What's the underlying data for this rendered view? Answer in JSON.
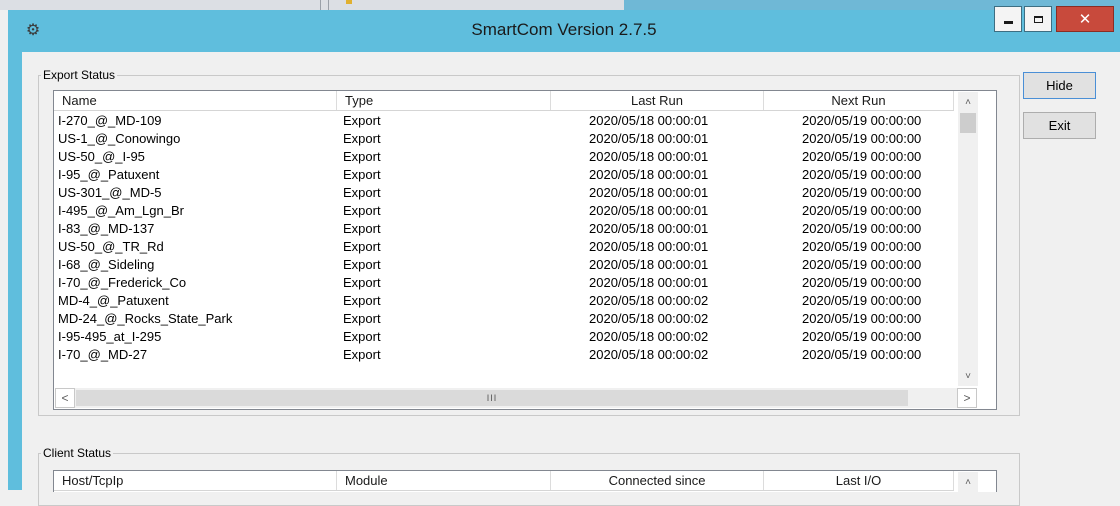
{
  "window": {
    "title": "SmartCom Version 2.7.5"
  },
  "buttons": {
    "hide_label": "Hide",
    "exit_label": "Exit"
  },
  "export_status": {
    "legend": "Export Status",
    "columns": [
      "Name",
      "Type",
      "Last Run",
      "Next Run"
    ],
    "rows": [
      {
        "name": "I-270_@_MD-109",
        "type": "Export",
        "last_run": "2020/05/18 00:00:01",
        "next_run": "2020/05/19 00:00:00"
      },
      {
        "name": "US-1_@_Conowingo",
        "type": "Export",
        "last_run": "2020/05/18 00:00:01",
        "next_run": "2020/05/19 00:00:00"
      },
      {
        "name": "US-50_@_I-95",
        "type": "Export",
        "last_run": "2020/05/18 00:00:01",
        "next_run": "2020/05/19 00:00:00"
      },
      {
        "name": "I-95_@_Patuxent",
        "type": "Export",
        "last_run": "2020/05/18 00:00:01",
        "next_run": "2020/05/19 00:00:00"
      },
      {
        "name": "US-301_@_MD-5",
        "type": "Export",
        "last_run": "2020/05/18 00:00:01",
        "next_run": "2020/05/19 00:00:00"
      },
      {
        "name": "I-495_@_Am_Lgn_Br",
        "type": "Export",
        "last_run": "2020/05/18 00:00:01",
        "next_run": "2020/05/19 00:00:00"
      },
      {
        "name": "I-83_@_MD-137",
        "type": "Export",
        "last_run": "2020/05/18 00:00:01",
        "next_run": "2020/05/19 00:00:00"
      },
      {
        "name": "US-50_@_TR_Rd",
        "type": "Export",
        "last_run": "2020/05/18 00:00:01",
        "next_run": "2020/05/19 00:00:00"
      },
      {
        "name": "I-68_@_Sideling",
        "type": "Export",
        "last_run": "2020/05/18 00:00:01",
        "next_run": "2020/05/19 00:00:00"
      },
      {
        "name": "I-70_@_Frederick_Co",
        "type": "Export",
        "last_run": "2020/05/18 00:00:01",
        "next_run": "2020/05/19 00:00:00"
      },
      {
        "name": "MD-4_@_Patuxent",
        "type": "Export",
        "last_run": "2020/05/18 00:00:02",
        "next_run": "2020/05/19 00:00:00"
      },
      {
        "name": "MD-24_@_Rocks_State_Park",
        "type": "Export",
        "last_run": "2020/05/18 00:00:02",
        "next_run": "2020/05/19 00:00:00"
      },
      {
        "name": "I-95-495_at_I-295",
        "type": "Export",
        "last_run": "2020/05/18 00:00:02",
        "next_run": "2020/05/19 00:00:00"
      },
      {
        "name": "I-70_@_MD-27",
        "type": "Export",
        "last_run": "2020/05/18 00:00:02",
        "next_run": "2020/05/19 00:00:00"
      }
    ],
    "hscroll_grip": "III"
  },
  "client_status": {
    "legend": "Client Status",
    "columns": [
      "Host/TcpIp",
      "Module",
      "Connected since",
      "Last I/O"
    ]
  },
  "colors": {
    "titlebar": "#5fbedd",
    "close_button": "#c84a3c",
    "dialog_background": "#f0f0f0"
  },
  "icons": {
    "app": "gear-icon",
    "minimize": "minimize-icon",
    "maximize": "maximize-icon",
    "close": "close-icon"
  }
}
